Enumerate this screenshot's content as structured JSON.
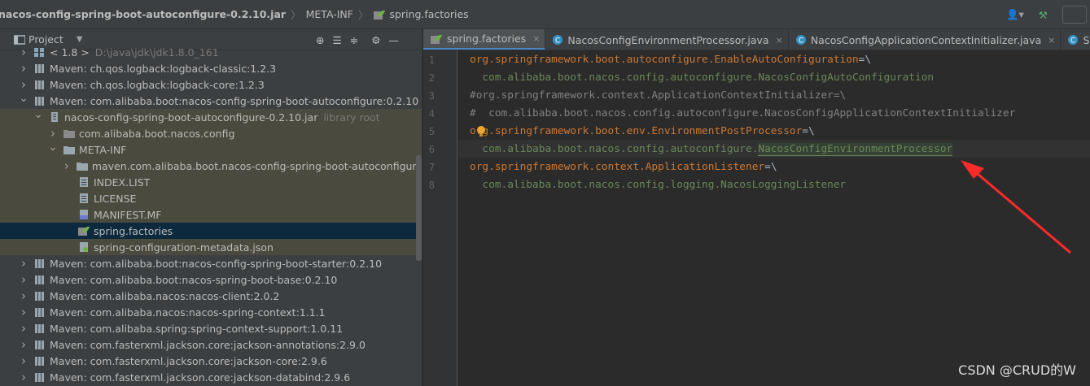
{
  "breadcrumb": {
    "items": [
      "nacos-config-spring-boot-autoconfigure-0.2.10.jar",
      "META-INF",
      "spring.factories"
    ]
  },
  "project_panel": {
    "title": "Project",
    "tree": [
      {
        "label": "< 1.8 >",
        "extra": "D:\\java\\jdk\\jdk1.8.0_161",
        "icon": "jdk-icon",
        "expanded": false
      },
      {
        "label": "Maven: ch.qos.logback:logback-classic:1.2.3",
        "icon": "library-icon",
        "expanded": false
      },
      {
        "label": "Maven: ch.qos.logback:logback-core:1.2.3",
        "icon": "library-icon",
        "expanded": false
      },
      {
        "label": "Maven: com.alibaba.boot:nacos-config-spring-boot-autoconfigure:0.2.10",
        "icon": "library-icon",
        "expanded": true
      },
      {
        "label": "nacos-config-spring-boot-autoconfigure-0.2.10.jar",
        "extra": "library root",
        "icon": "jar-icon",
        "expanded": true
      },
      {
        "label": "com.alibaba.boot.nacos.config",
        "icon": "package-icon",
        "expanded": false
      },
      {
        "label": "META-INF",
        "icon": "folder-icon",
        "expanded": true
      },
      {
        "label": "maven.com.alibaba.boot.nacos-config-spring-boot-autoconfigure",
        "icon": "folder-icon",
        "expanded": false
      },
      {
        "label": "INDEX.LIST",
        "icon": "text-file-icon"
      },
      {
        "label": "LICENSE",
        "icon": "text-file-icon"
      },
      {
        "label": "MANIFEST.MF",
        "icon": "manifest-file-icon"
      },
      {
        "label": "spring.factories",
        "icon": "spring-file-icon"
      },
      {
        "label": "spring-configuration-metadata.json",
        "icon": "json-file-icon"
      },
      {
        "label": "Maven: com.alibaba.boot:nacos-config-spring-boot-starter:0.2.10",
        "icon": "library-icon",
        "expanded": false
      },
      {
        "label": "Maven: com.alibaba.boot:nacos-spring-boot-base:0.2.10",
        "icon": "library-icon",
        "expanded": false
      },
      {
        "label": "Maven: com.alibaba.nacos:nacos-client:2.0.2",
        "icon": "library-icon",
        "expanded": false
      },
      {
        "label": "Maven: com.alibaba.nacos:nacos-spring-context:1.1.1",
        "icon": "library-icon",
        "expanded": false
      },
      {
        "label": "Maven: com.alibaba.spring:spring-context-support:1.0.11",
        "icon": "library-icon",
        "expanded": false
      },
      {
        "label": "Maven: com.fasterxml.jackson.core:jackson-annotations:2.9.0",
        "icon": "library-icon",
        "expanded": false
      },
      {
        "label": "Maven: com.fasterxml.jackson.core:jackson-core:2.9.6",
        "icon": "library-icon",
        "expanded": false
      },
      {
        "label": "Maven: com.fasterxml.jackson.core:jackson-databind:2.9.6",
        "icon": "library-icon",
        "expanded": false
      }
    ]
  },
  "editor": {
    "tabs": [
      {
        "label": "spring.factories",
        "icon": "spring-file-icon",
        "active": true
      },
      {
        "label": "NacosConfigEnvironmentProcessor.java",
        "icon": "class-icon",
        "active": false
      },
      {
        "label": "NacosConfigApplicationContextInitializer.java",
        "icon": "class-icon",
        "active": false
      },
      {
        "label": "SpringApp",
        "icon": "class-icon",
        "active": false
      }
    ],
    "line_numbers": [
      "1",
      "2",
      "3",
      "4",
      "5",
      "6",
      "7",
      "8"
    ],
    "lines": [
      {
        "key": "org.springframework.boot.autoconfigure.EnableAutoConfiguration",
        "op": "=\\"
      },
      {
        "val": "  com.alibaba.boot.nacos.config.autoconfigure.NacosConfigAutoConfiguration"
      },
      {
        "cmt": "#org.springframework.context.ApplicationContextInitializer=\\"
      },
      {
        "cmt": "#  com.alibaba.boot.nacos.config.autoconfigure.NacosConfigApplicationContextInitializer"
      },
      {
        "key": "org.springframework.boot.env.EnvironmentPostProcessor",
        "op": "=\\"
      },
      {
        "val": "  com.alibaba.boot.nacos.config.autoconfigure.",
        "hl": "NacosConfigEnvironmentProcessor"
      },
      {
        "key": "org.springframework.context.ApplicationListener",
        "op": "=\\"
      },
      {
        "val": "  com.alibaba.boot.nacos.config.logging.NacosLoggingListener"
      }
    ]
  },
  "watermark": "CSDN @CRUD的W",
  "colors": {
    "key": "#cc7832",
    "value": "#6a8759",
    "comment": "#808080",
    "annotation_arrow": "#ff2a2a",
    "selection": "#0d293e"
  }
}
